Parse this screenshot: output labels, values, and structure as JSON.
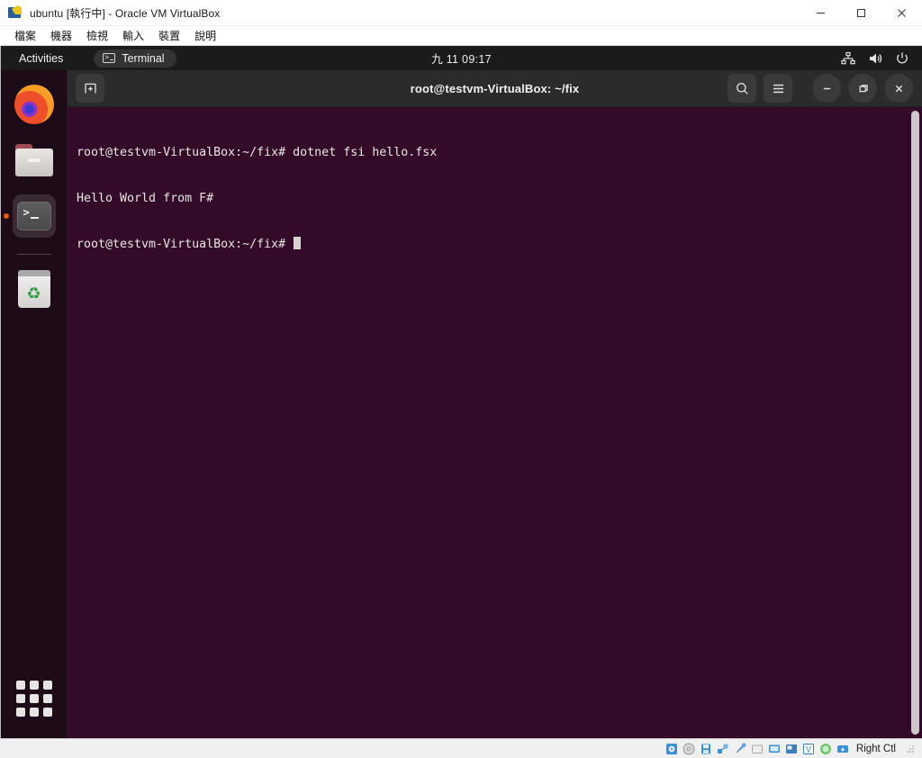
{
  "host_window": {
    "title": "ubuntu [執行中] - Oracle VM VirtualBox",
    "app_icon": "virtualbox-icon",
    "window_controls": {
      "minimize": "minimize-icon",
      "maximize": "maximize-icon",
      "close": "close-icon"
    },
    "menubar": [
      {
        "label": "檔案"
      },
      {
        "label": "機器"
      },
      {
        "label": "檢視"
      },
      {
        "label": "輸入"
      },
      {
        "label": "裝置"
      },
      {
        "label": "說明"
      }
    ]
  },
  "guest": {
    "topbar": {
      "activities": "Activities",
      "app_indicator": {
        "label": "Terminal",
        "icon": "terminal-icon"
      },
      "clock": "九 11 09:17",
      "tray": [
        {
          "icon": "network-wired-icon"
        },
        {
          "icon": "volume-icon"
        },
        {
          "icon": "power-icon"
        }
      ]
    },
    "dock": {
      "items": [
        {
          "name": "firefox",
          "icon": "firefox-icon",
          "active": false
        },
        {
          "name": "files",
          "icon": "files-folder-icon",
          "active": false
        },
        {
          "name": "terminal",
          "icon": "terminal-app-icon",
          "active": true
        },
        {
          "name": "trash",
          "icon": "trash-icon",
          "active": false
        }
      ],
      "show_apps": "show-applications-icon"
    },
    "terminal": {
      "title": "root@testvm-VirtualBox: ~/fix",
      "new_tab_icon": "new-tab-icon",
      "search_icon": "search-icon",
      "menu_icon": "hamburger-menu-icon",
      "minimize_icon": "minimize-icon",
      "maximize_icon": "maximize-icon",
      "close_icon": "close-icon",
      "lines": [
        "root@testvm-VirtualBox:~/fix# dotnet fsi hello.fsx",
        "Hello World from F#",
        "root@testvm-VirtualBox:~/fix# "
      ],
      "background_color": "#330a28",
      "foreground_color": "#e8e6e3"
    }
  },
  "status_bar": {
    "host_key": "Right Ctl",
    "indicators": [
      {
        "icon": "hard-disk-icon"
      },
      {
        "icon": "optical-disk-icon"
      },
      {
        "icon": "floppy-icon"
      },
      {
        "icon": "network-icon"
      },
      {
        "icon": "usb-icon"
      },
      {
        "icon": "shared-folder-icon"
      },
      {
        "icon": "display-icon"
      },
      {
        "icon": "recording-icon"
      },
      {
        "icon": "virtualization-icon"
      },
      {
        "icon": "mouse-icon"
      },
      {
        "icon": "keyboard-icon"
      }
    ]
  }
}
